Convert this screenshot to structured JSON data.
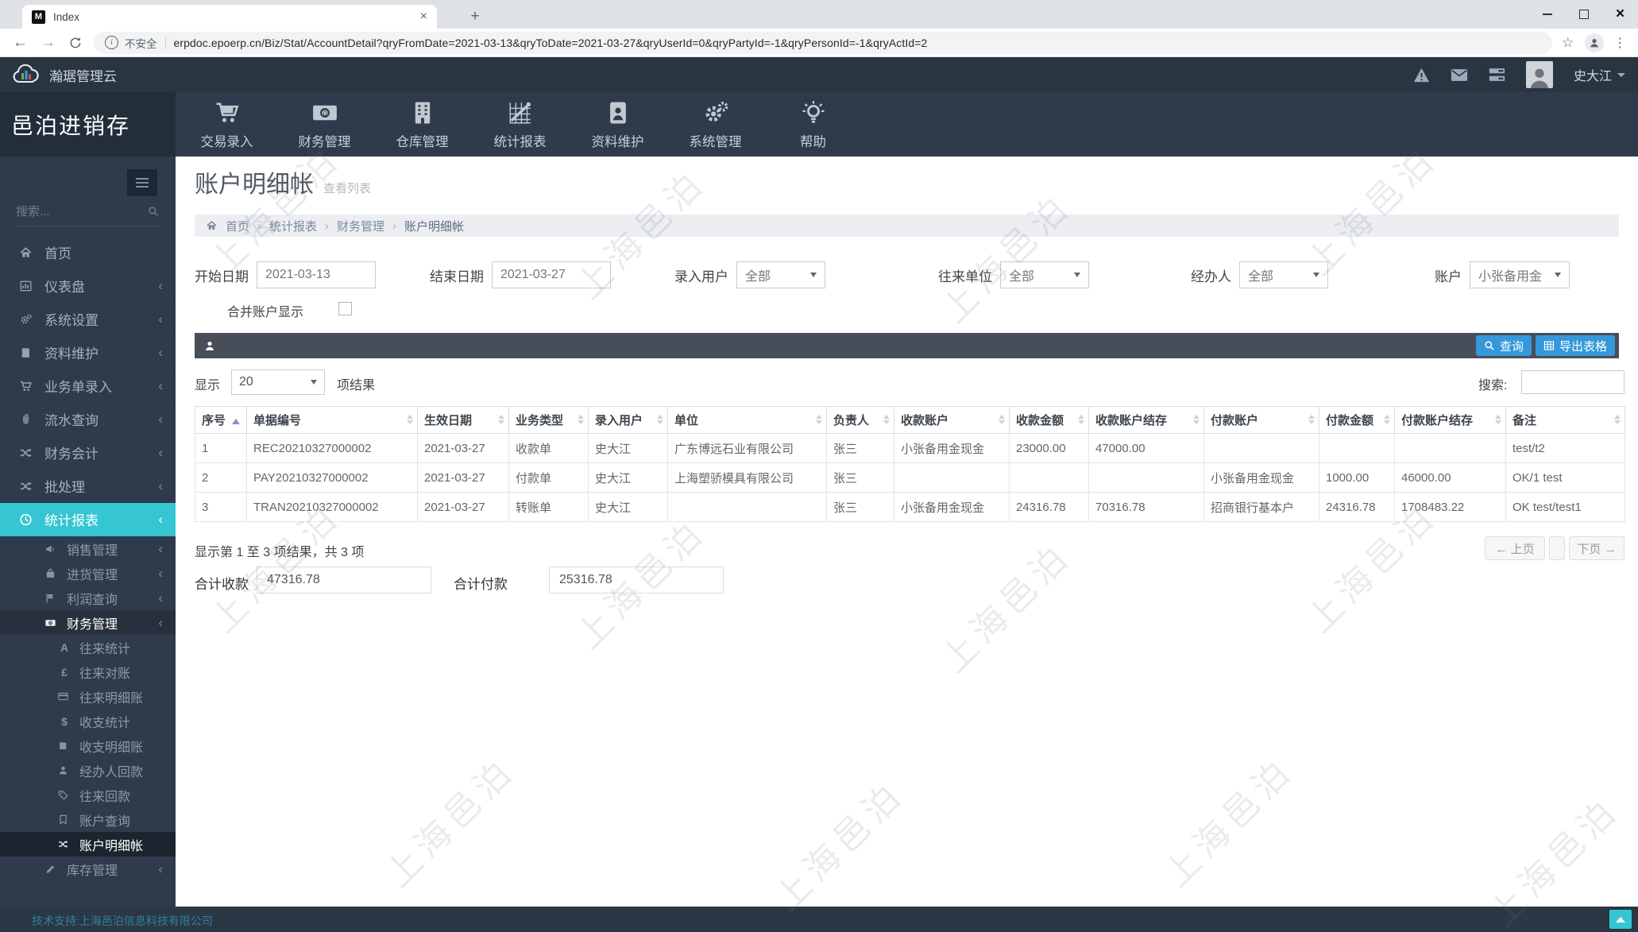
{
  "browser": {
    "tab_title": "Index",
    "favicon_letter": "M",
    "security_label": "不安全",
    "url": "erpdoc.epoerp.cn/Biz/Stat/AccountDetail?qryFromDate=2021-03-13&qryToDate=2021-03-27&qryUserId=0&qryPartyId=-1&qryPersonId=-1&qryActId=2"
  },
  "header": {
    "cloud_title": "瀚琚管理云",
    "user_name": "史大江",
    "icons": [
      "alert-icon",
      "envelope-icon",
      "tasks-icon"
    ]
  },
  "brand": {
    "title": "邑泊进销存"
  },
  "topnav": {
    "items": [
      {
        "label": "交易录入",
        "icon": "cart-icon"
      },
      {
        "label": "财务管理",
        "icon": "money-icon"
      },
      {
        "label": "仓库管理",
        "icon": "building-icon"
      },
      {
        "label": "统计报表",
        "icon": "chart-icon"
      },
      {
        "label": "资料维护",
        "icon": "idcard-icon"
      },
      {
        "label": "系统管理",
        "icon": "gears-icon"
      },
      {
        "label": "帮助",
        "icon": "bulb-icon"
      }
    ]
  },
  "sidebar": {
    "search_placeholder": "搜索...",
    "items": [
      {
        "label": "首页",
        "icon": "home-icon"
      },
      {
        "label": "仪表盘",
        "icon": "dashboard-icon"
      },
      {
        "label": "系统设置",
        "icon": "gears-icon"
      },
      {
        "label": "资料维护",
        "icon": "book-icon"
      },
      {
        "label": "业务单录入",
        "icon": "cart-icon"
      },
      {
        "label": "流水查询",
        "icon": "paperclip-icon"
      },
      {
        "label": "财务会计",
        "icon": "shuffle-icon"
      },
      {
        "label": "批处理",
        "icon": "shuffle-icon"
      },
      {
        "label": "统计报表",
        "icon": "clock-icon"
      },
      {
        "label": "销售管理",
        "icon": "megaphone-icon"
      },
      {
        "label": "进货管理",
        "icon": "bag-icon"
      },
      {
        "label": "利润查询",
        "icon": "flag-icon"
      },
      {
        "label": "财务管理",
        "icon": "money-icon"
      },
      {
        "label": "往来统计",
        "icon": "letter-a-icon"
      },
      {
        "label": "往来对账",
        "icon": "pound-icon"
      },
      {
        "label": "往来明细账",
        "icon": "card-icon"
      },
      {
        "label": "收支统计",
        "icon": "dollar-icon"
      },
      {
        "label": "收支明细账",
        "icon": "ledger-icon"
      },
      {
        "label": "经办人回款",
        "icon": "person-icon"
      },
      {
        "label": "往来回款",
        "icon": "tag-icon"
      },
      {
        "label": "账户查询",
        "icon": "bookmark-icon"
      },
      {
        "label": "账户明细帐",
        "icon": "shuffle-icon"
      },
      {
        "label": "库存管理",
        "icon": "pencil-icon"
      }
    ],
    "footer_text": "技术支持:上海邑泊信息科技有限公司"
  },
  "page": {
    "title": "账户明细帐",
    "subtitle": "查看列表",
    "breadcrumb": [
      "首页",
      "统计报表",
      "财务管理",
      "账户明细帐"
    ]
  },
  "filters": {
    "start_date_label": "开始日期",
    "start_date": "2021-03-13",
    "end_date_label": "结束日期",
    "end_date": "2021-03-27",
    "entry_user_label": "录入用户",
    "entry_user": "全部",
    "party_label": "往来单位",
    "party": "全部",
    "agent_label": "经办人",
    "agent": "全部",
    "account_label": "账户",
    "account": "小张备用金",
    "merge_label": "合并账户显示"
  },
  "toolbar": {
    "query_label": "查询",
    "export_label": "导出表格"
  },
  "table_controls": {
    "show_label": "显示",
    "page_size": "20",
    "results_label": "项结果",
    "search_label": "搜索:"
  },
  "table": {
    "headers": [
      "序号",
      "单据编号",
      "生效日期",
      "业务类型",
      "录入用户",
      "单位",
      "负责人",
      "收款账户",
      "收款金额",
      "收款账户结存",
      "付款账户",
      "付款金额",
      "付款账户结存",
      "备注"
    ],
    "rows": [
      [
        "1",
        "REC20210327000002",
        "2021-03-27",
        "收款单",
        "史大江",
        "广东博远石业有限公司",
        "张三",
        "小张备用金现金",
        "23000.00",
        "47000.00",
        "",
        "",
        "",
        "test/t2"
      ],
      [
        "2",
        "PAY20210327000002",
        "2021-03-27",
        "付款单",
        "史大江",
        "上海塑骄模具有限公司",
        "张三",
        "",
        "",
        "",
        "小张备用金现金",
        "1000.00",
        "46000.00",
        "OK/1 test"
      ],
      [
        "3",
        "TRAN20210327000002",
        "2021-03-27",
        "转账单",
        "史大江",
        "",
        "张三",
        "小张备用金现金",
        "24316.78",
        "70316.78",
        "招商银行基本户",
        "24316.78",
        "1708483.22",
        "OK test/test1"
      ]
    ],
    "summary": "显示第 1 至 3 项结果，共 3 项",
    "prev_label": "← 上页",
    "next_label": "下页 →"
  },
  "totals": {
    "receipt_label": "合计收款",
    "receipt_value": "47316.78",
    "payment_label": "合计付款",
    "payment_value": "25316.78"
  },
  "watermark": "上海邑泊",
  "colors": {
    "accent_teal": "#36c6d3",
    "button_blue": "#3598db",
    "sidebar_dark": "#2f3b4c"
  }
}
